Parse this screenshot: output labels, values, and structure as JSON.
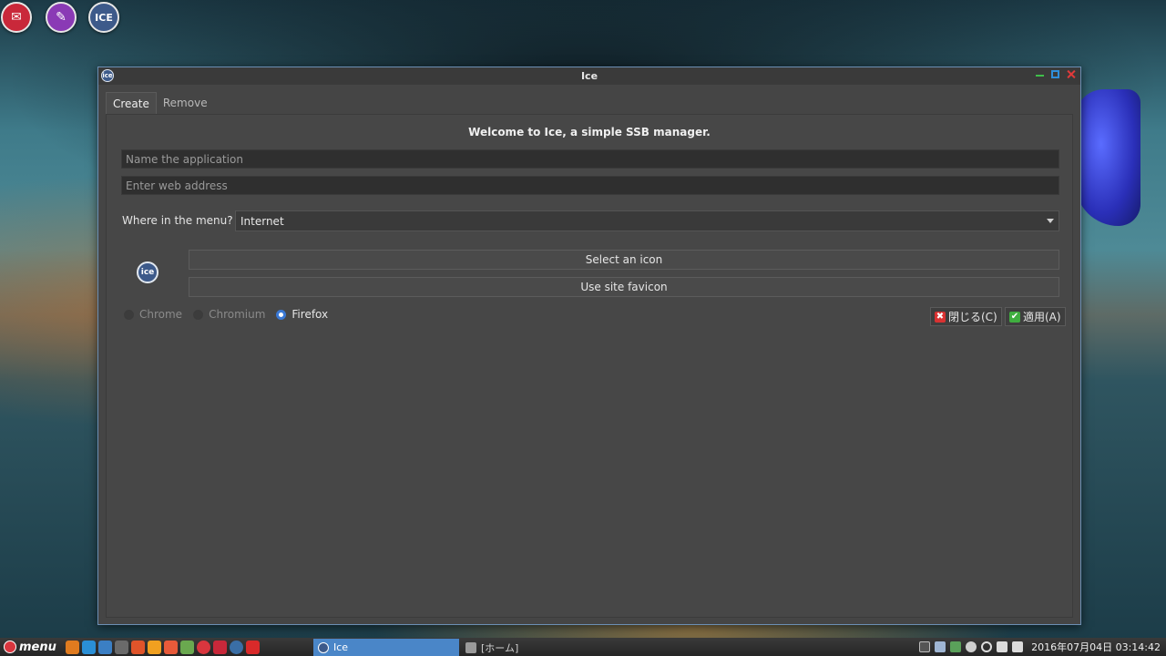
{
  "desktop": {
    "icons": [
      {
        "name": "mail-icon",
        "glyph": "✉"
      },
      {
        "name": "paint-icon",
        "glyph": "✎"
      },
      {
        "name": "ice-icon",
        "glyph": "ICE"
      }
    ]
  },
  "window": {
    "title": "Ice",
    "tabs": [
      {
        "label": "Create",
        "active": true
      },
      {
        "label": "Remove",
        "active": false
      }
    ],
    "welcome": "Welcome to Ice, a simple SSB manager.",
    "name_placeholder": "Name the application",
    "url_placeholder": "Enter web address",
    "menu_label": "Where in the menu?",
    "menu_value": "Internet",
    "select_icon_label": "Select an icon",
    "favicon_label": "Use site favicon",
    "browsers": [
      {
        "label": "Chrome",
        "checked": false
      },
      {
        "label": "Chromium",
        "checked": false
      },
      {
        "label": "Firefox",
        "checked": true
      }
    ],
    "close_label": "閉じる(C)",
    "apply_label": "適用(A)"
  },
  "taskbar": {
    "menu_label": "menu",
    "tasks": [
      {
        "label": "Ice",
        "active": true
      },
      {
        "label": "[ホーム]",
        "active": false
      }
    ],
    "clock": "2016年07月04日 03:14:42"
  },
  "colors": {
    "accent": "#4a86c8",
    "radio_checked": "#3a78d4",
    "close_icon": "#d93232",
    "apply_icon": "#3fae3f"
  }
}
